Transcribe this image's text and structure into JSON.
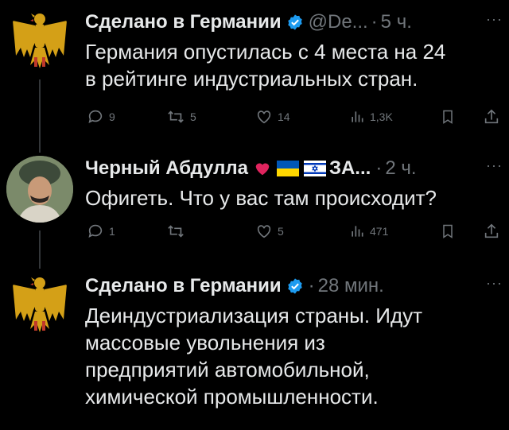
{
  "tweets": [
    {
      "author": "Сделано в Германии",
      "handle": "@De...",
      "separator": "·",
      "time": "5 ч.",
      "more": "···",
      "text": "Германия опустилась с 4 места на 24\nв рейтинге индустриальных стран.",
      "replies": "9",
      "retweets": "5",
      "likes": "14",
      "views": "1,3K"
    },
    {
      "author": "Черный Абдулла",
      "name_suffix": "ЗА...",
      "separator": "·",
      "time": "2 ч.",
      "more": "···",
      "text": "Офигеть. Что у вас там происходит?",
      "replies": "1",
      "retweets": "",
      "likes": "5",
      "views": "471"
    },
    {
      "author": "Сделано в Германии",
      "separator": "·",
      "time": "28 мин.",
      "more": "···",
      "text": "Деиндустриализация страны. Идут\nмассовые увольнения из\nпредприятий автомобильной,\nхимической  промышленности."
    }
  ],
  "colors": {
    "background": "#000000",
    "text": "#e7e9ea",
    "muted": "#71767b",
    "verified": "#1d9bf0",
    "heart": "#f91880",
    "eagle_gold": "#d4a017"
  }
}
